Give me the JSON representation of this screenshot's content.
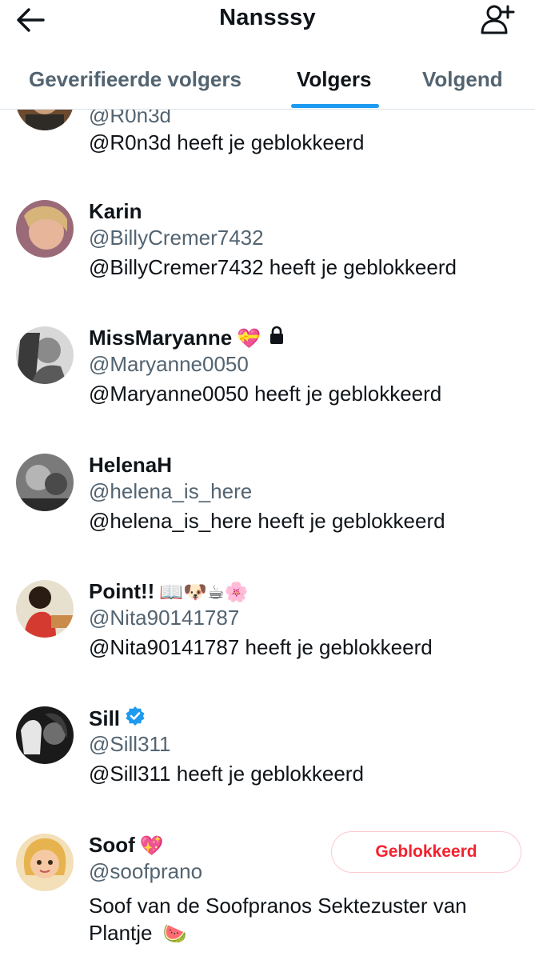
{
  "header": {
    "title": "Nansssy",
    "back_icon": "back-arrow-icon",
    "add_icon": "add-user-icon"
  },
  "tabs": [
    {
      "label": "Geverifieerde volgers",
      "active": false
    },
    {
      "label": "Volgers",
      "active": true
    },
    {
      "label": "Volgend",
      "active": false
    }
  ],
  "accent_color": "#1d9bf0",
  "users": [
    {
      "name": "",
      "handle": "@R0n3d",
      "status": "@R0n3d heeft je geblokkeerd"
    },
    {
      "name": "Karin",
      "handle": "@BillyCremer7432",
      "status": "@BillyCremer7432 heeft je geblokkeerd"
    },
    {
      "name": "MissMaryanne",
      "name_emoji": "💝",
      "locked": true,
      "handle": "@Maryanne0050",
      "status": "@Maryanne0050 heeft je geblokkeerd"
    },
    {
      "name": "HelenaH",
      "handle": "@helena_is_here",
      "status": "@helena_is_here heeft je geblokkeerd"
    },
    {
      "name": "Point!!",
      "name_emoji": "📖🐶☕🌸",
      "handle": "@Nita90141787",
      "status": "@Nita90141787 heeft je geblokkeerd"
    },
    {
      "name": "Sill",
      "verified": true,
      "handle": "@Sill311",
      "status": "@Sill311 heeft je geblokkeerd"
    },
    {
      "name": "Soof",
      "name_emoji": "💖",
      "handle": "@soofprano",
      "bio_line1": "Soof van de Soofpranos Sektezuster van",
      "bio_line2": "Plantje",
      "bio_emoji": "🍉",
      "button_label": "Geblokkeerd"
    }
  ]
}
